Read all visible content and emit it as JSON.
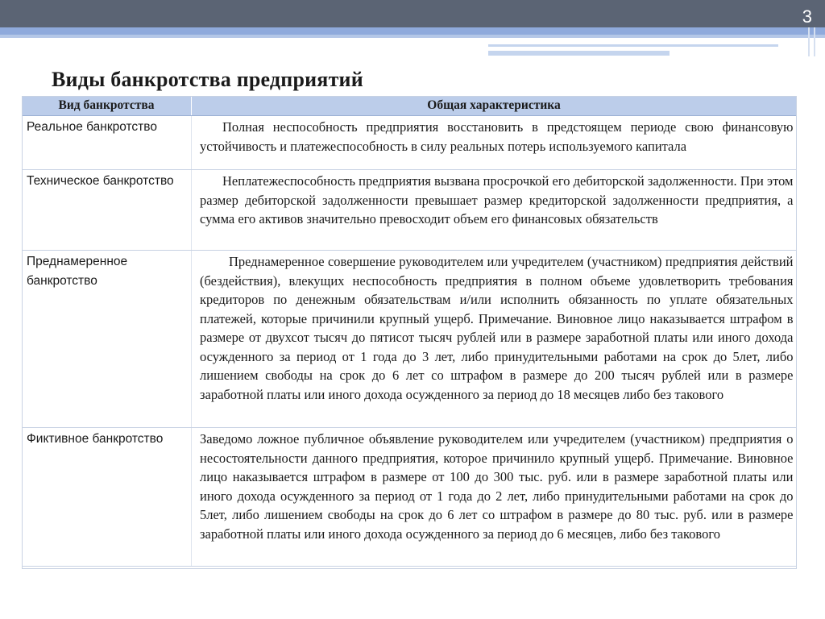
{
  "slide": {
    "number": "3",
    "title": "Виды банкротства предприятий"
  },
  "table": {
    "headers": [
      "Вид банкротства",
      "Общая характеристика"
    ],
    "rows": [
      {
        "type": "Реальное банкротство",
        "description": "Полная неспособность предприятия восстановить в предстоящем периоде свою финансовую устойчивость и платежеспособность в силу реальных потерь используемого капитала"
      },
      {
        "type": "Техническое банкротство",
        "description": "Неплатежеспособность предприятия вызвана просрочкой его дебиторской задолженности. При этом размер дебиторской задолженности превышает размер кредиторской задолженности предприятия, а сумма его активов значительно превосходит объем его финансовых обязательств"
      },
      {
        "type": "Преднамеренное банкротство",
        "description": "Преднамеренное совершение руководителем или учредителем (участником) предприятия действий (бездействия), влекущих неспособность предприятия в полном объеме удовлетворить требования кредиторов по денежным обязательствам и/или исполнить обязанность по уплате обязательных платежей, которые причинили крупный ущерб. Примечание. Виновное лицо наказывается штрафом в размере от двухсот тысяч до пятисот тысяч рублей или в размере заработной платы или иного дохода осужденного за период от 1 года до 3 лет, либо принудительными работами на срок до 5лет, либо лишением свободы на срок до 6 лет со штрафом в размере до 200 тысяч рублей или в размере заработной платы или иного дохода осужденного за период до 18 месяцев либо без такового"
      },
      {
        "type": "Фиктивное банкротство",
        "description": "Заведомо ложное публичное объявление руководителем или учредителем (участником) предприятия о несостоятельности данного предприятия, которое причинило крупный ущерб. Примечание. Виновное лицо наказывается штрафом в размере от 100 до 300 тыс. руб. или в размере заработной платы или иного дохода осужденного за период от 1 года до 2 лет, либо принудительными работами на срок до 5лет, либо лишением свободы на срок до 6 лет со штрафом в размере до 80 тыс. руб. или в размере заработной платы или иного дохода осужденного за период до 6 месяцев, либо без такового"
      }
    ]
  },
  "colors": {
    "header_band": "#5b6474",
    "accent_blue": "#8faadc",
    "table_header": "#bccdea"
  }
}
